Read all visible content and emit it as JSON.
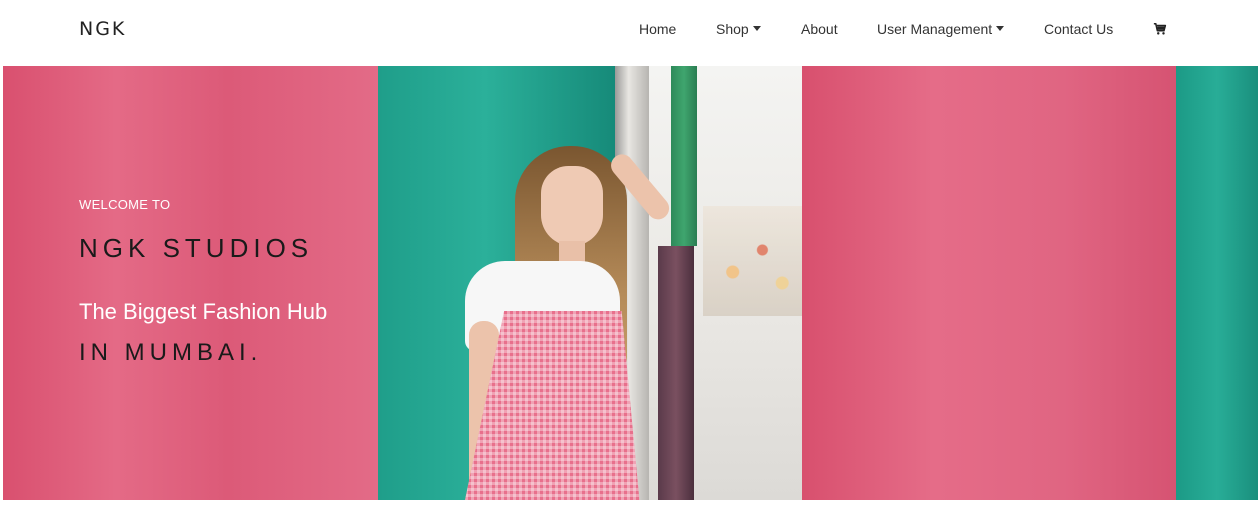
{
  "navbar": {
    "brand": "NGK",
    "links": {
      "home": "Home",
      "shop": "Shop",
      "about": "About",
      "user_management": "User Management",
      "contact": "Contact Us"
    },
    "cart_icon": "shopping-cart-icon"
  },
  "hero": {
    "welcome": "WELCOME TO",
    "title": "NGK STUDIOS",
    "tagline": "The Biggest Fashion Hub",
    "city": "IN MUMBAI."
  },
  "colors": {
    "pink": "#e0627f",
    "teal": "#23a590",
    "nav_text": "#333333"
  }
}
